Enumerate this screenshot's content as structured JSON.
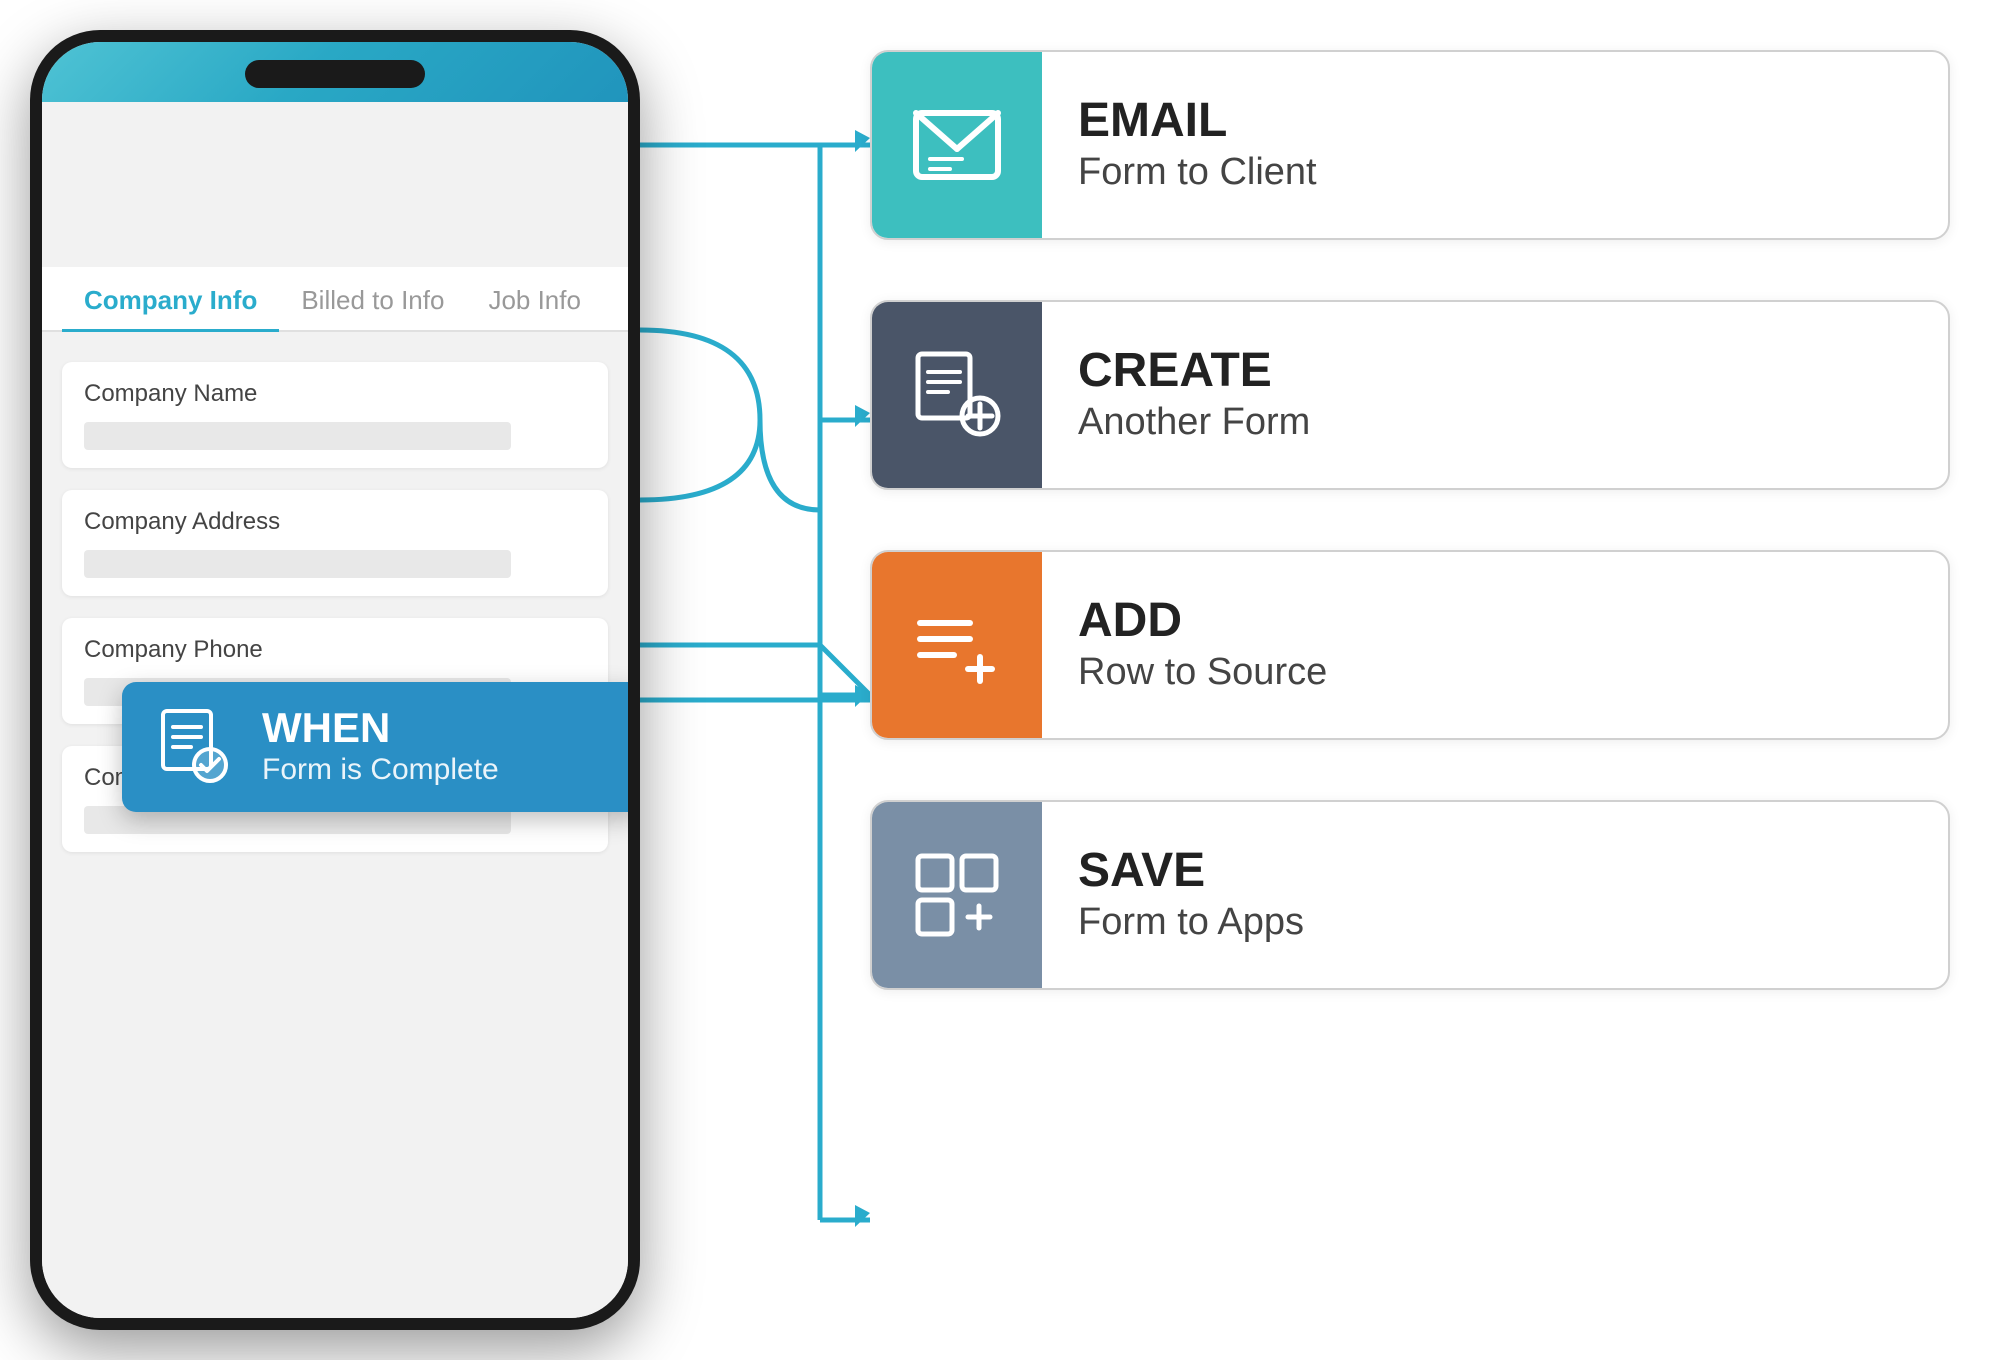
{
  "phone": {
    "tabs": [
      {
        "label": "Company Info",
        "active": true
      },
      {
        "label": "Billed to Info",
        "active": false
      },
      {
        "label": "Job Info",
        "active": false
      }
    ],
    "fields": [
      {
        "label": "Company Name"
      },
      {
        "label": "Company Address"
      },
      {
        "label": "Company Phone"
      },
      {
        "label": "Company Email"
      }
    ]
  },
  "when_box": {
    "title": "WHEN",
    "subtitle": "Form is Complete"
  },
  "actions": [
    {
      "id": "email",
      "color": "teal",
      "title": "EMAIL",
      "subtitle": "Form to Client"
    },
    {
      "id": "create",
      "color": "dark",
      "title": "CREATE",
      "subtitle": "Another Form"
    },
    {
      "id": "add",
      "color": "orange",
      "title": "ADD",
      "subtitle": "Row to Source"
    },
    {
      "id": "save",
      "color": "slate",
      "title": "SAVE",
      "subtitle": "Form to Apps"
    }
  ],
  "connector_color": "#2aaccc"
}
